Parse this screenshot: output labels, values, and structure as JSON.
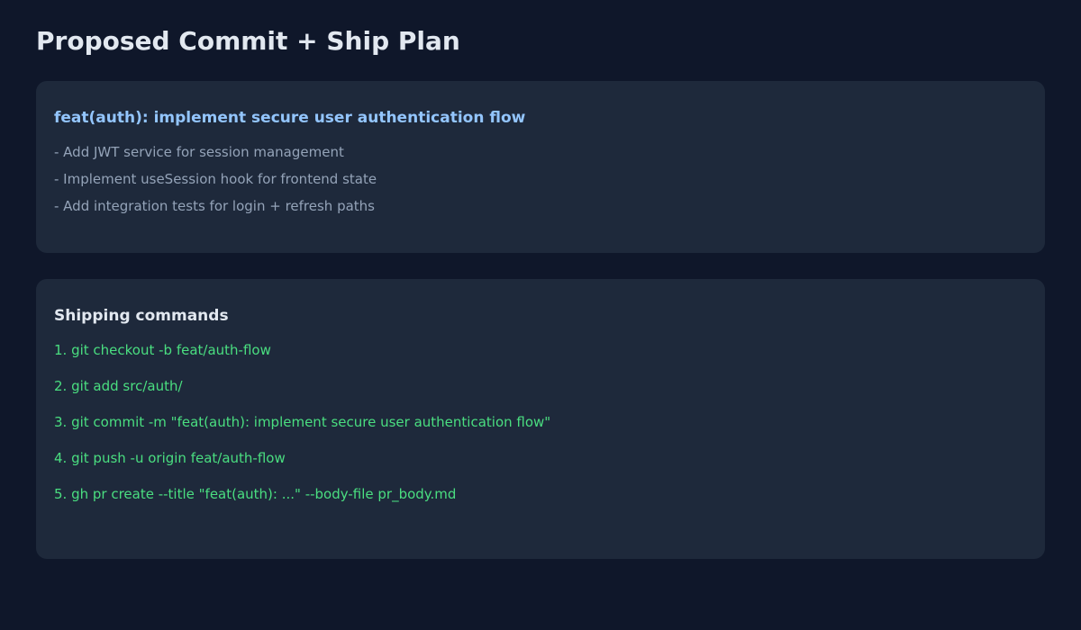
{
  "page": {
    "title": "Proposed Commit + Ship Plan"
  },
  "commit": {
    "subject": "feat(auth): implement secure user authentication flow",
    "body": [
      "- Add JWT service for session management",
      "- Implement useSession hook for frontend state",
      "- Add integration tests for login + refresh paths"
    ]
  },
  "shipping": {
    "heading": "Shipping commands",
    "commands": [
      "1. git checkout -b feat/auth-flow",
      "2. git add src/auth/",
      "3. git commit -m \"feat(auth): implement secure user authentication flow\"",
      "4. git push -u origin feat/auth-flow",
      "5. gh pr create --title \"feat(auth): ...\" --body-file pr_body.md"
    ]
  },
  "colors": {
    "background": "#0f172a",
    "card": "#1e293b",
    "commit_subject": "#93c5fd",
    "body_text": "#94a3b8",
    "command_text": "#4ade80",
    "heading_text": "#e2e8f0"
  }
}
